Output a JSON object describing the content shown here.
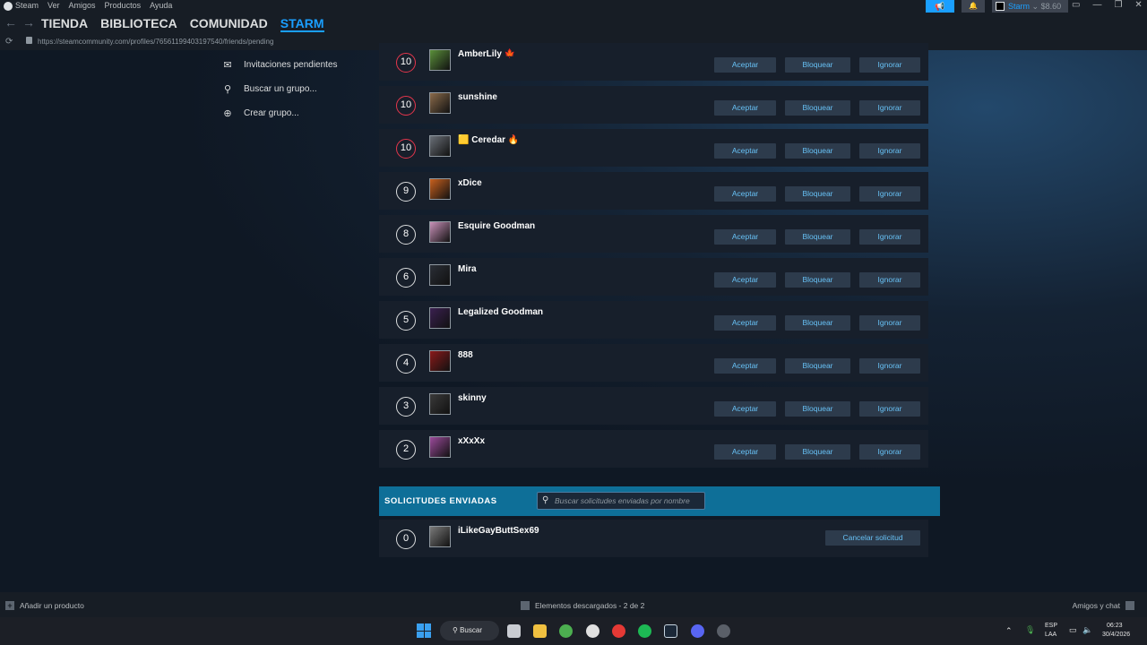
{
  "menubar": {
    "items": [
      "Steam",
      "Ver",
      "Amigos",
      "Productos",
      "Ayuda"
    ]
  },
  "nav": {
    "links": [
      "TIENDA",
      "BIBLIOTECA",
      "COMUNIDAD",
      "STARM"
    ]
  },
  "url": "https://steamcommunity.com/profiles/76561199403197540/friends/pending",
  "account": {
    "name": "Starm",
    "balance": "$8.60"
  },
  "sidebar": {
    "items": [
      {
        "label": "Invitaciones pendientes",
        "icon": "mail-icon"
      },
      {
        "label": "Buscar un grupo...",
        "icon": "search-icon"
      },
      {
        "label": "Crear grupo...",
        "icon": "plus-circle-icon"
      }
    ]
  },
  "buttons": {
    "accept": "Aceptar",
    "block": "Bloquear",
    "ignore": "Ignorar",
    "cancel": "Cancelar solicitud"
  },
  "received": [
    {
      "level": "10",
      "name": "AmberLily 🍁",
      "color": "#5a8f3a"
    },
    {
      "level": "10",
      "name": "sunshine",
      "color": "#8a6a4a"
    },
    {
      "level": "10",
      "name": "🟨 Ceredar 🔥",
      "color": "#6a7078"
    },
    {
      "level": "9",
      "name": "xDice",
      "color": "#c8601e"
    },
    {
      "level": "8",
      "name": "Esquire Goodman",
      "color": "#c890b8"
    },
    {
      "level": "6",
      "name": "Mira",
      "color": "#2a2e36"
    },
    {
      "level": "5",
      "name": "Legalized Goodman",
      "color": "#3a2050"
    },
    {
      "level": "4",
      "name": "888",
      "color": "#8a1a1a"
    },
    {
      "level": "3",
      "name": "skinny",
      "color": "#3a3a3a"
    },
    {
      "level": "2",
      "name": "xXxXx",
      "color": "#9a4a9a"
    }
  ],
  "sent": {
    "title": "SOLICITUDES ENVIADAS",
    "search_placeholder": "Buscar solicitudes enviadas por nombre",
    "items": [
      {
        "level": "0",
        "name": "iLikeGayButtSex69",
        "color": "#7a7a7a"
      }
    ]
  },
  "bottombar": {
    "add_product": "Añadir un producto",
    "downloads": "Elementos descargados - 2 de 2",
    "friends_chat": "Amigos y chat"
  },
  "taskbar": {
    "search": "Buscar",
    "lang1": "ESP",
    "lang2": "LAA",
    "time": "06:23",
    "date": "30/4/2026"
  }
}
